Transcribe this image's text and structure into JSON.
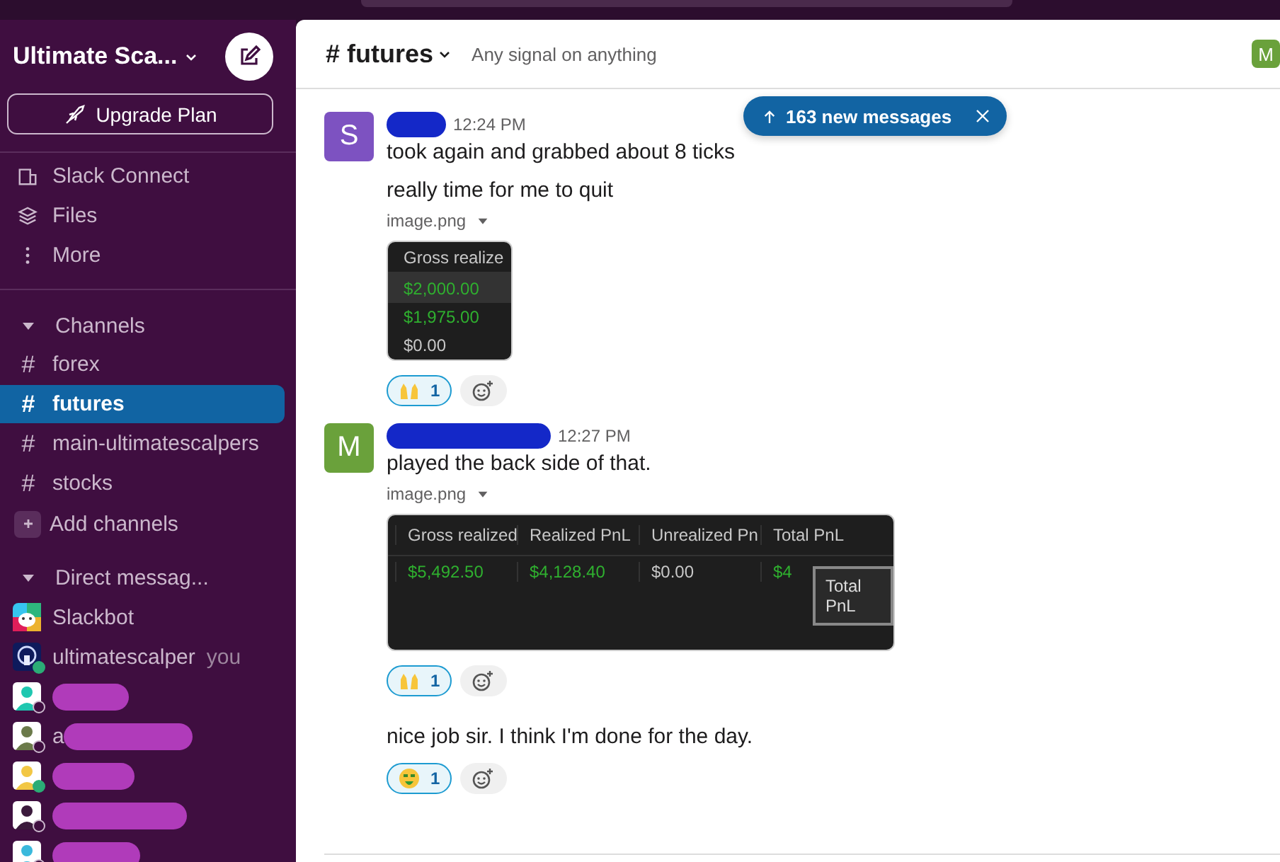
{
  "workspace": {
    "name": "Ultimate Sca...",
    "upgrade_button": "Upgrade Plan"
  },
  "nav_items": [
    {
      "label": "Slack Connect",
      "kind": "connect"
    },
    {
      "label": "Files",
      "kind": "files"
    },
    {
      "label": "More",
      "kind": "more"
    }
  ],
  "channels_section": {
    "title": "Channels",
    "expanded": true
  },
  "channels": [
    {
      "icon": "#",
      "name": "forex",
      "selected": false
    },
    {
      "icon": "#",
      "name": "futures",
      "selected": true
    },
    {
      "icon": "#",
      "name": "main-ultimatescalpers",
      "selected": false
    },
    {
      "icon": "#",
      "name": "stocks",
      "selected": false
    }
  ],
  "add_channels": "Add channels",
  "dm_section": {
    "title": "Direct messag...",
    "expanded": true
  },
  "direct_messages": [
    {
      "kind": "slackbot",
      "name": "Slackbot"
    },
    {
      "kind": "self",
      "name": "ultimatescalper",
      "suffix": "you",
      "online": true
    },
    {
      "kind": "redacted",
      "color": "#1fc7b0",
      "online": false
    },
    {
      "kind": "redacted",
      "name": "a",
      "color": "#6b7a4a",
      "online": false
    },
    {
      "kind": "redacted",
      "color": "#f2c744",
      "online": true
    },
    {
      "kind": "redacted",
      "color": "#3b1a3c",
      "online": false
    },
    {
      "kind": "redacted",
      "color": "#3ab9dc",
      "online": false
    }
  ],
  "header": {
    "hash": "#",
    "channel": "futures",
    "topic": "Any signal on anything",
    "member_avatar": "M"
  },
  "new_messages_banner": {
    "text": "163 new messages"
  },
  "messages": [
    {
      "avatar": "S",
      "color": "#7d52c1",
      "time": "12:24 PM",
      "lines": [
        "took again and grabbed about 8 ticks",
        "really time for me to quit"
      ],
      "attachment": {
        "filename": "image.png",
        "kind": "narrow",
        "columns": [
          "Gross realize"
        ],
        "rows": [
          {
            "cells": [
              "$2,000.00"
            ],
            "selected": true,
            "green": true
          },
          {
            "cells": [
              "$1,975.00"
            ],
            "selected": false,
            "green": true
          },
          {
            "cells": [
              "$0.00"
            ],
            "selected": false,
            "green": false
          }
        ]
      },
      "reactions": [
        {
          "kind": "raised_hands",
          "count": "1",
          "selected": true
        }
      ]
    },
    {
      "avatar": "M",
      "color": "#6aa13b",
      "time": "12:27 PM",
      "lines": [
        "played the back side of that."
      ],
      "attachment": {
        "filename": "image.png",
        "kind": "wide",
        "columns": [
          "Gross realized",
          "Realized PnL",
          "Unrealized Pn",
          "Total PnL"
        ],
        "rows": [
          {
            "cells": [
              "$5,492.50",
              "$4,128.40",
              "$0.00",
              "$4"
            ],
            "selected": false,
            "green": true
          }
        ],
        "tooltip": "Total PnL"
      },
      "reactions": [
        {
          "kind": "raised_hands",
          "count": "1",
          "selected": true
        }
      ]
    },
    {
      "lines": [
        "nice job sir. I think I'm done for the day."
      ],
      "reactions": [
        {
          "kind": "money_mouth",
          "count": "1",
          "selected": true
        }
      ]
    }
  ]
}
